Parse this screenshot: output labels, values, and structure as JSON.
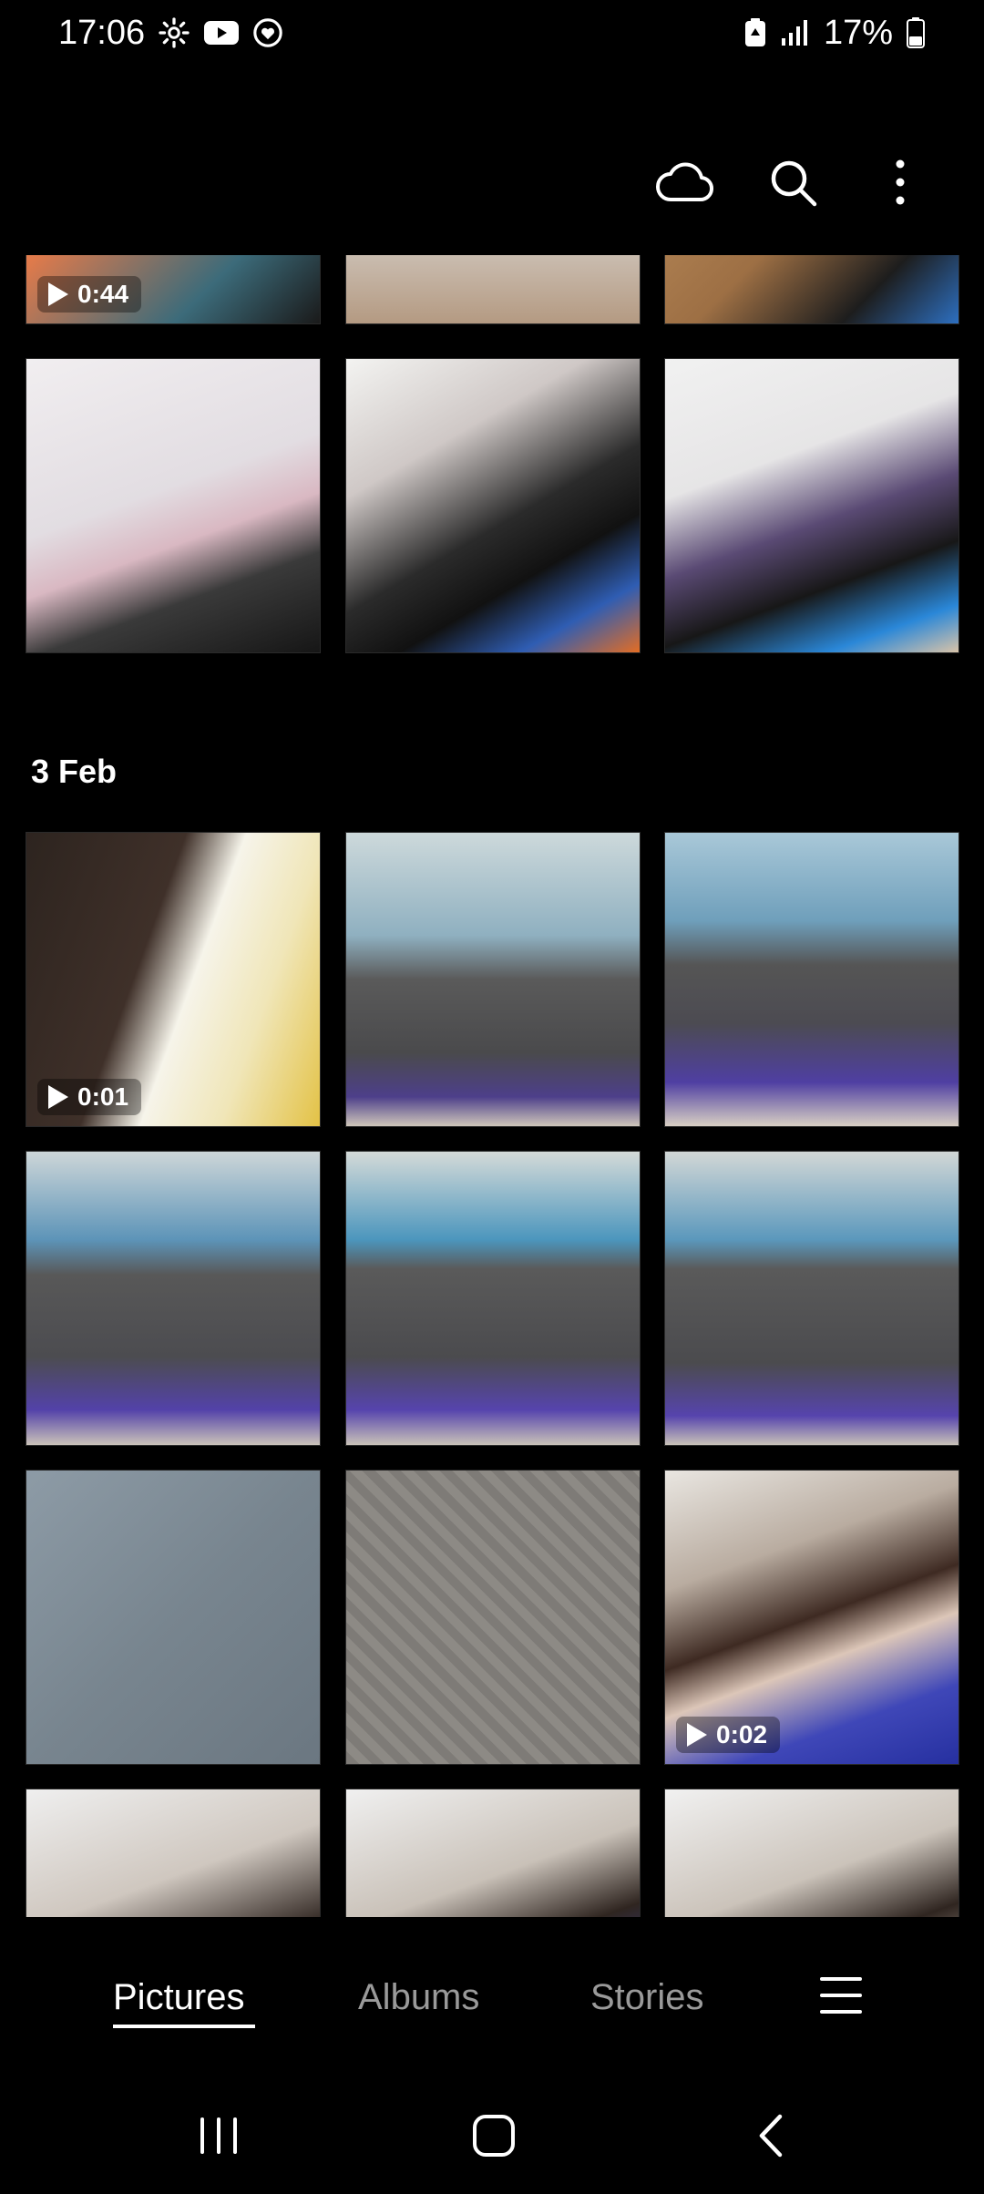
{
  "status_bar": {
    "time": "17:06",
    "battery_percent": "17%",
    "left_icons": [
      "gear-icon",
      "youtube-icon",
      "heart-icon"
    ],
    "right_icons": [
      "battery-saver-icon",
      "signal-icon",
      "battery-icon"
    ]
  },
  "action_bar": {
    "icons": [
      "cloud-icon",
      "search-icon",
      "more-icon"
    ]
  },
  "sections": [
    {
      "date": "",
      "items": [
        {
          "type": "video",
          "duration": "0:44"
        },
        {
          "type": "image"
        },
        {
          "type": "image"
        },
        {
          "type": "image"
        },
        {
          "type": "image"
        },
        {
          "type": "image"
        }
      ]
    },
    {
      "date": "3 Feb",
      "items": [
        {
          "type": "video",
          "duration": "0:01"
        },
        {
          "type": "image"
        },
        {
          "type": "image"
        },
        {
          "type": "image"
        },
        {
          "type": "image"
        },
        {
          "type": "image"
        },
        {
          "type": "image"
        },
        {
          "type": "image"
        },
        {
          "type": "video",
          "duration": "0:02"
        },
        {
          "type": "image"
        },
        {
          "type": "image"
        },
        {
          "type": "image"
        }
      ]
    }
  ],
  "tabs": {
    "pictures": "Pictures",
    "albums": "Albums",
    "stories": "Stories",
    "active": "pictures"
  },
  "nav_bar": {
    "icons": [
      "recents-icon",
      "home-icon",
      "back-icon"
    ]
  }
}
